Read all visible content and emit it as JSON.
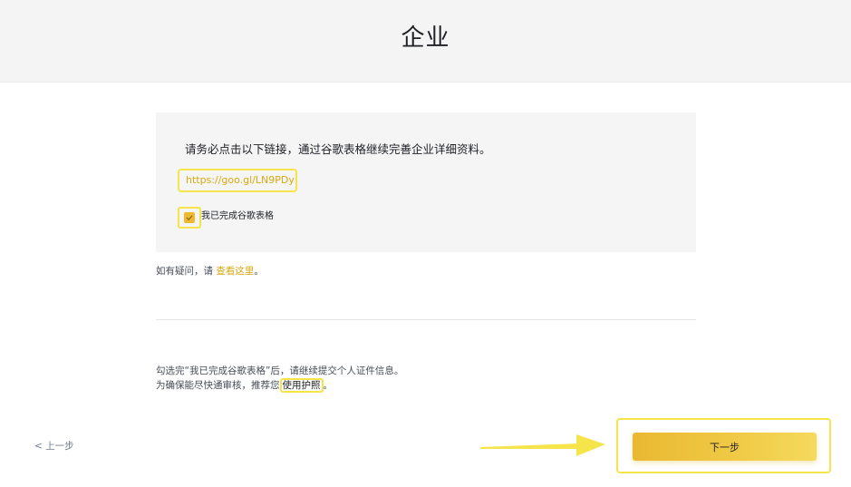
{
  "header": {
    "title": "企业"
  },
  "card": {
    "instruction": "请务必点击以下链接，通过谷歌表格继续完善企业详细资料。",
    "form_link": "https://goo.gl/LN9PDy",
    "checkbox_label": "我已完成谷歌表格",
    "checkbox_checked": true
  },
  "help": {
    "prefix": "如有疑问，请 ",
    "link": "查看这里",
    "suffix": "。"
  },
  "note": {
    "line1": "勾选完“我已完成谷歌表格”后，请继续提交个人证件信息。",
    "line2_prefix": "为确保能尽快通审核，推荐您",
    "line2_link": "使用护照",
    "line2_suffix": "。"
  },
  "footer": {
    "back_label": "< 上一步",
    "next_label": "下一步"
  },
  "colors": {
    "accent": "#f0b90b",
    "highlight": "#f5e44a",
    "link": "#d9a80e"
  }
}
